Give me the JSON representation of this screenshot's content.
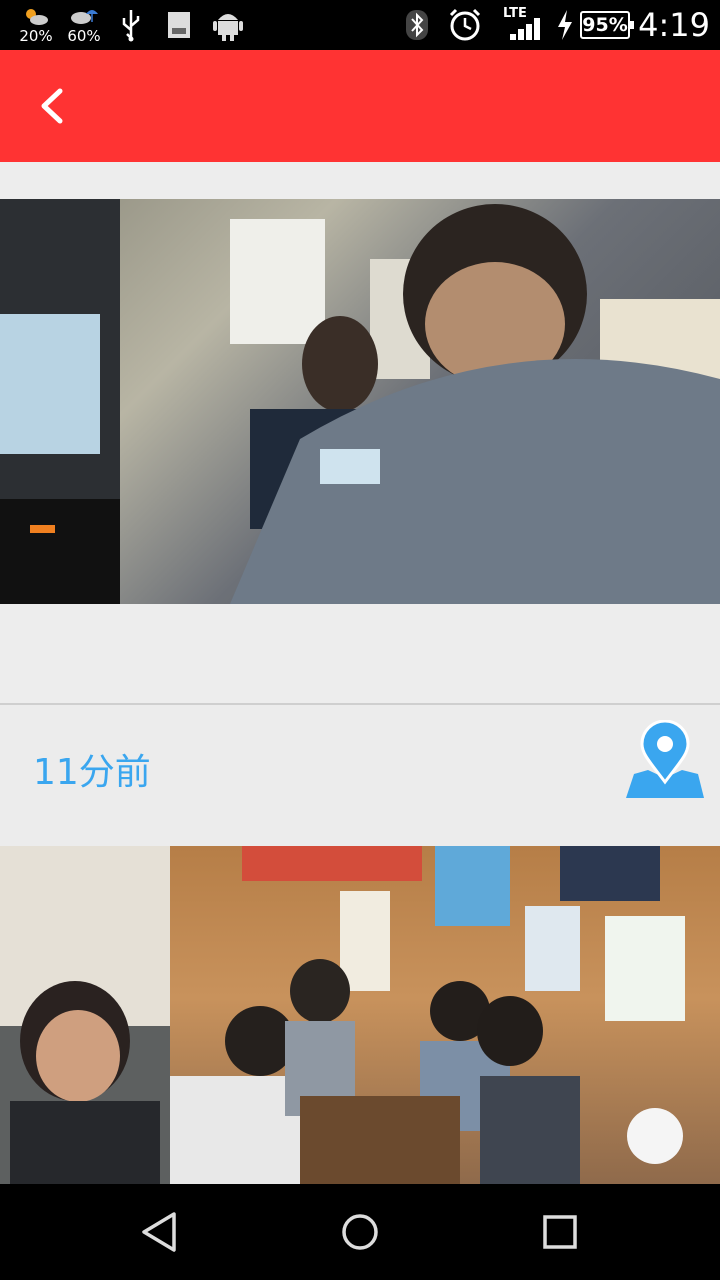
{
  "status_bar": {
    "weather_1": "20%",
    "weather_2": "60%",
    "network": "LTE",
    "battery": "95%",
    "clock": "4:19"
  },
  "post": {
    "time_ago": "11分前"
  },
  "icons": {
    "back": "chevron-left-icon",
    "map": "map-pin-icon"
  },
  "colors": {
    "app_bar": "#ff3333",
    "accent": "#3aa6ef",
    "background": "#ededed"
  }
}
